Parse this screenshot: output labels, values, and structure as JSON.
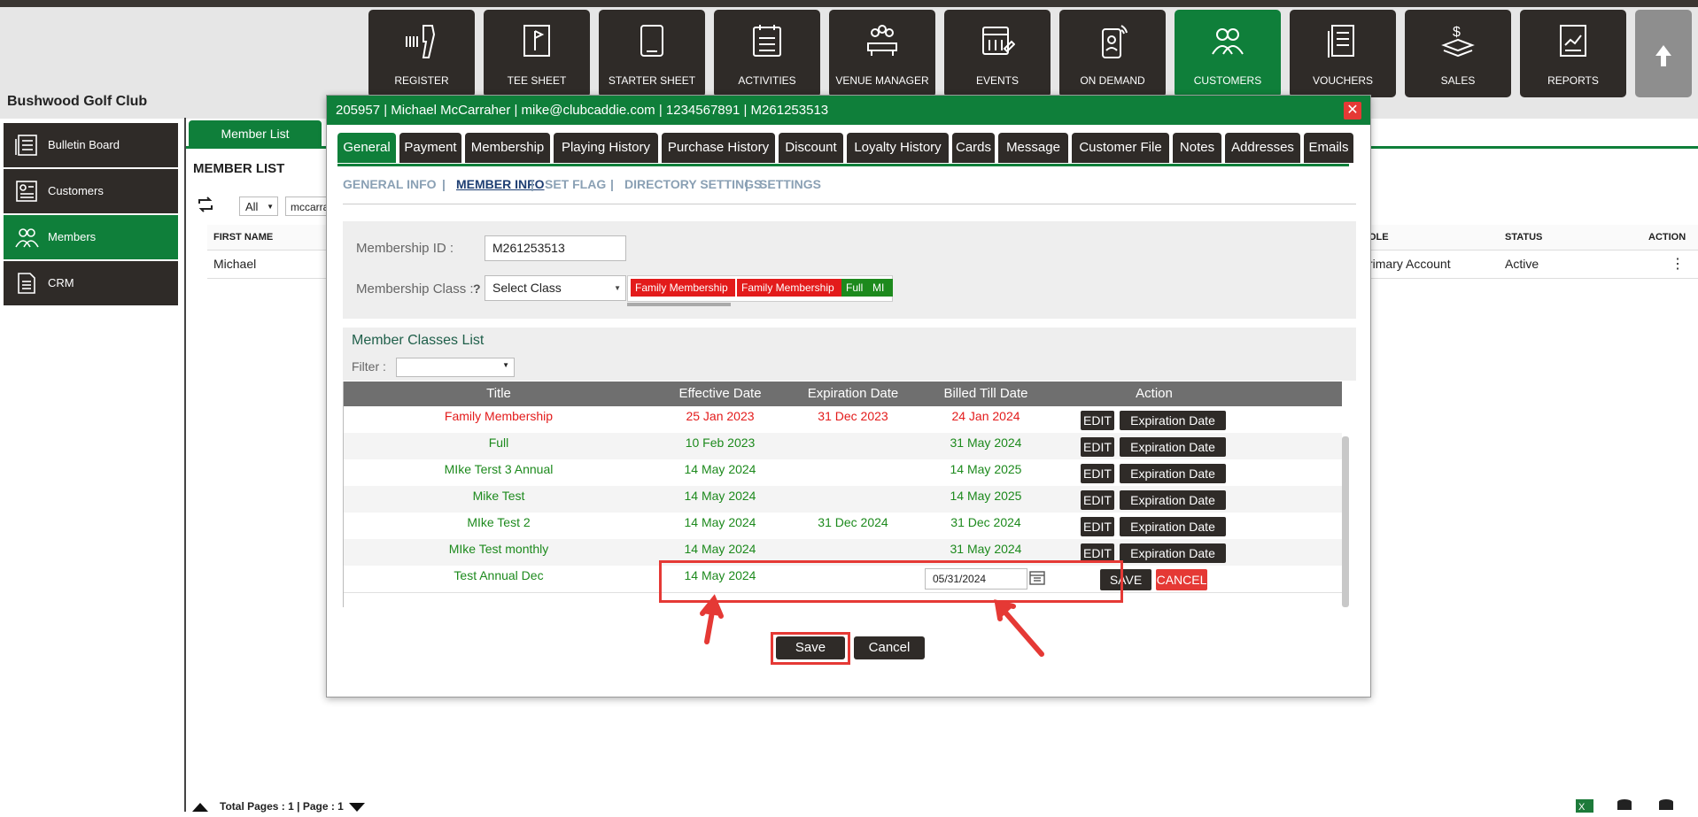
{
  "app": {
    "club_name": "Bushwood Golf Club"
  },
  "nav": [
    {
      "label": "REGISTER",
      "icon": "barcode-scanner-icon"
    },
    {
      "label": "TEE SHEET",
      "icon": "tee-sheet-icon"
    },
    {
      "label": "STARTER SHEET",
      "icon": "tablet-icon"
    },
    {
      "label": "ACTIVITIES",
      "icon": "calendar-list-icon"
    },
    {
      "label": "VENUE MANAGER",
      "icon": "meeting-icon"
    },
    {
      "label": "EVENTS",
      "icon": "event-calendar-icon"
    },
    {
      "label": "ON DEMAND",
      "icon": "mobile-signal-icon"
    },
    {
      "label": "CUSTOMERS",
      "icon": "customers-icon"
    },
    {
      "label": "VOUCHERS",
      "icon": "voucher-icon"
    },
    {
      "label": "SALES",
      "icon": "sales-money-icon"
    },
    {
      "label": "REPORTS",
      "icon": "reports-icon"
    }
  ],
  "sidebar": [
    {
      "label": "Bulletin Board"
    },
    {
      "label": "Customers"
    },
    {
      "label": "Members"
    },
    {
      "label": "CRM"
    }
  ],
  "member_list": {
    "tab_label": "Member List",
    "title": "MEMBER LIST",
    "filter_all": "All",
    "search_value": "mccarra",
    "columns": {
      "first_name": "FIRST NAME",
      "role": "OLE",
      "status": "STATUS",
      "action": "ACTION"
    },
    "row": {
      "first_name": "Michael",
      "role": "rimary Account",
      "status": "Active",
      "action": "⋮"
    },
    "footer": "Total Pages : 1 | Page : 1"
  },
  "modal": {
    "header": "205957 | Michael McCarraher | mike@clubcaddie.com | 1234567891 | M261253513",
    "close": "✕",
    "tabs": [
      "General",
      "Payment",
      "Membership",
      "Playing History",
      "Purchase History",
      "Discount",
      "Loyalty History",
      "Cards",
      "Message",
      "Customer File",
      "Notes",
      "Addresses",
      "Emails"
    ],
    "subnav": [
      "GENERAL INFO",
      "MEMBER INFO",
      "SET FLAG",
      "DIRECTORY SETTINGS",
      "SETTINGS"
    ],
    "sep": "|",
    "membership_id_label": "Membership ID :",
    "membership_id_value": "M261253513",
    "membership_class_label": "Membership Class :",
    "help": "?",
    "select_class": "Select Class",
    "tags": [
      {
        "text": "Family Membership",
        "color": "#e31b1b"
      },
      {
        "text": "Family Membership",
        "color": "#e31b1b"
      },
      {
        "text": "Full",
        "color": "#1d8a1d"
      },
      {
        "text": "MI",
        "color": "#1d8a1d"
      }
    ],
    "classes_title": "Member Classes List",
    "filter_label": "Filter :",
    "table_headers": [
      "Title",
      "Effective Date",
      "Expiration Date",
      "Billed Till Date",
      "Action"
    ],
    "rows": [
      {
        "title": "Family Membership",
        "effective": "25 Jan 2023",
        "expiration": "31 Dec 2023",
        "billed": "24 Jan 2024",
        "color": "#e31b1b"
      },
      {
        "title": "Full",
        "effective": "10 Feb 2023",
        "expiration": "",
        "billed": "31 May 2024",
        "color": "#1d8a1d"
      },
      {
        "title": "MIke Terst 3 Annual",
        "effective": "14 May 2024",
        "expiration": "",
        "billed": "14 May 2025",
        "color": "#1d8a1d"
      },
      {
        "title": "Mike Test",
        "effective": "14 May 2024",
        "expiration": "",
        "billed": "14 May 2025",
        "color": "#1d8a1d"
      },
      {
        "title": "MIke Test 2",
        "effective": "14 May 2024",
        "expiration": "31 Dec 2024",
        "billed": "31 Dec 2024",
        "color": "#1d8a1d"
      },
      {
        "title": "MIke Test monthly",
        "effective": "14 May 2024",
        "expiration": "",
        "billed": "31 May 2024",
        "color": "#1d8a1d"
      }
    ],
    "edit_label": "EDIT",
    "expiration_label": "Expiration Date",
    "edit_row": {
      "title": "Test Annual Dec",
      "effective": "14 May 2024",
      "billed_input": "05/31/2024",
      "save": "SAVE",
      "cancel": "CANCEL"
    },
    "save_button": "Save",
    "cancel_button": "Cancel"
  },
  "colors": {
    "brand_green": "#0f7f3a",
    "dark": "#2f2b28",
    "highlight_red": "#e53935"
  }
}
